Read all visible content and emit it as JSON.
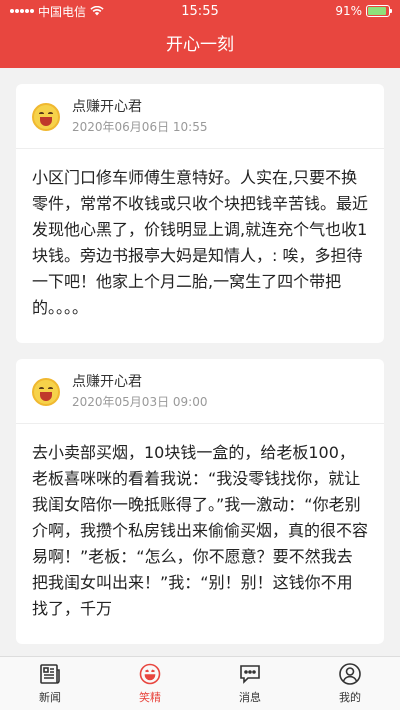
{
  "status_bar": {
    "carrier": "中国电信",
    "time": "15:55",
    "battery": "91%",
    "battery_level": 0.91
  },
  "header": {
    "title": "开心一刻"
  },
  "posts": [
    {
      "author": "点赚开心君",
      "date": "2020年06月06日 10:55",
      "content": "小区门口修车师傅生意特好。人实在,只要不换零件，常常不收钱或只收个块把钱辛苦钱。最近发现他心黑了，价钱明显上调,就连充个气也收1块钱。旁边书报亭大妈是知情人，: 唉，多担待一下吧！他家上个月二胎,一窝生了四个带把的。。。。"
    },
    {
      "author": "点赚开心君",
      "date": "2020年05月03日 09:00",
      "content": "去小卖部买烟，10块钱一盒的，给老板100，老板喜咪咪的看着我说：“我没零钱找你，就让我闺女陪你一晚抵账得了。”我一激动：“你老别介啊，我攒个私房钱出来偷偷买烟，真的很不容易啊！”老板：“怎么，你不愿意？要不然我去把我闺女叫出来！”我：“别！别！这钱你不用找了，千万"
    }
  ],
  "tabs": [
    {
      "label": "新闻",
      "icon": "news-icon"
    },
    {
      "label": "笑精",
      "icon": "laugh-face-icon"
    },
    {
      "label": "消息",
      "icon": "message-icon"
    },
    {
      "label": "我的",
      "icon": "profile-icon"
    }
  ],
  "colors": {
    "accent": "#e8463f"
  }
}
